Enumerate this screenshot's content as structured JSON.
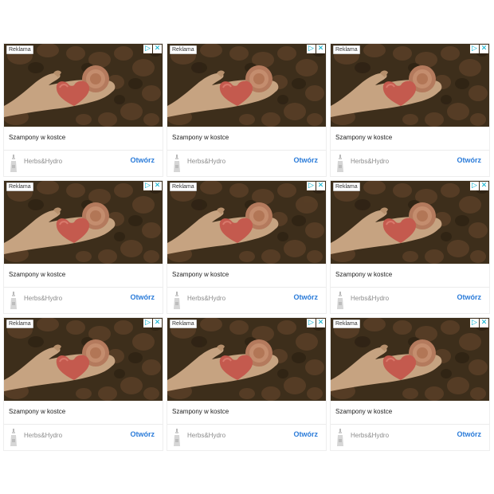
{
  "ads": [
    {
      "badge": "Reklama",
      "title": "Szampony w kostce",
      "advertiser": "Herbs&Hydro",
      "cta": "Otwórz"
    },
    {
      "badge": "Reklama",
      "title": "Szampony w kostce",
      "advertiser": "Herbs&Hydro",
      "cta": "Otwórz"
    },
    {
      "badge": "Reklama",
      "title": "Szampony w kostce",
      "advertiser": "Herbs&Hydro",
      "cta": "Otwórz"
    },
    {
      "badge": "Reklama",
      "title": "Szampony w kostce",
      "advertiser": "Herbs&Hydro",
      "cta": "Otwórz"
    },
    {
      "badge": "Reklama",
      "title": "Szampony w kostce",
      "advertiser": "Herbs&Hydro",
      "cta": "Otwórz"
    },
    {
      "badge": "Reklama",
      "title": "Szampony w kostce",
      "advertiser": "Herbs&Hydro",
      "cta": "Otwórz"
    },
    {
      "badge": "Reklama",
      "title": "Szampony w kostce",
      "advertiser": "Herbs&Hydro",
      "cta": "Otwórz"
    },
    {
      "badge": "Reklama",
      "title": "Szampony w kostce",
      "advertiser": "Herbs&Hydro",
      "cta": "Otwórz"
    },
    {
      "badge": "Reklama",
      "title": "Szampony w kostce",
      "advertiser": "Herbs&Hydro",
      "cta": "Otwórz"
    }
  ],
  "icons": {
    "adchoices": "adchoices-icon",
    "close": "close-icon",
    "advertiser_logo": "bottle-logo-icon"
  },
  "colors": {
    "cta": "#2a7bd9",
    "adchoices": "#00aecd"
  }
}
